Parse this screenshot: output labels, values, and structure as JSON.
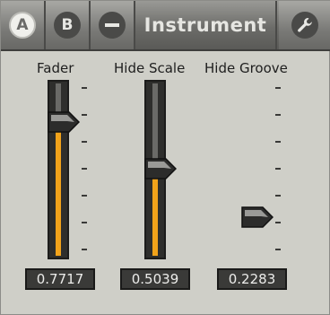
{
  "header": {
    "tab_a_label": "A",
    "tab_b_label": "B",
    "title": "Instrument"
  },
  "sliders": [
    {
      "label": "Fader",
      "value_text": "0.7717",
      "value": 0.7717
    },
    {
      "label": "Hide Scale",
      "value_text": "0.5039",
      "value": 0.5039
    },
    {
      "label": "Hide Groove",
      "value_text": "0.2283",
      "value": 0.2283
    }
  ],
  "colors": {
    "fill": "#f2a31a",
    "track": "#2e2e2c",
    "panel": "#cfcfc8"
  },
  "icons": [
    "minus-icon",
    "wrench-icon"
  ]
}
